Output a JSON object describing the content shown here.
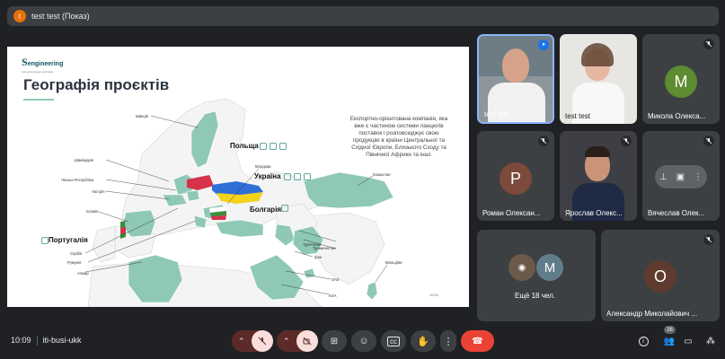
{
  "meeting": {
    "presenter_initial": "t",
    "presenting_label": "test test (Показ)",
    "time": "10:09",
    "code": "iti-busi-ukk",
    "participants_count": "26"
  },
  "slide": {
    "logo_letter": "S",
    "logo_text": "engineering",
    "logo_subtext": "інтелектуальні системи",
    "title": "Географія проєктів",
    "description": "Експортно-орієнтована компанія, яка вже є частиною системи ланцюгів поставок і розповсюджує свою продукцію в країни Центральної та Східної Європи, Близького Сходу та Північної Африки та інші.",
    "big_labels": {
      "poland": "Польща",
      "ukraine": "Україна",
      "bulgaria": "Болгарія",
      "portugal": "Португалія"
    },
    "country_labels": {
      "sweden": "Швеція",
      "switzerland": "Швейцарія",
      "czech": "Чеська Республіка",
      "austria": "Австрія",
      "spain": "Іспанія",
      "serbia": "Сербія",
      "romania": "Румунія",
      "algeria": "Алжир",
      "moldova": "Молдова",
      "kazakhstan": "Казахстан",
      "turkey": "Туреччина",
      "turkmenistan": "Туркменістан",
      "iran": "Іран",
      "uae": "ОАЕ",
      "ksa": "KSA",
      "maldives": "Мальдіви"
    },
    "page_number": "10/34"
  },
  "tiles": [
    {
      "name": "test test",
      "type": "video",
      "speaking": true
    },
    {
      "name": "test test",
      "type": "video"
    },
    {
      "name": "Микола Олекса...",
      "type": "avatar",
      "initial": "M",
      "color": "#5e8c31",
      "muted": true
    },
    {
      "name": "Роман Олексан...",
      "type": "avatar",
      "initial": "P",
      "color": "#7b4a3a",
      "muted": true
    },
    {
      "name": "Ярослав Олекс...",
      "type": "video",
      "muted": true
    },
    {
      "name": "Вячеслав Олек...",
      "type": "hover",
      "muted": true
    },
    {
      "name": "Ещё 18 чел.",
      "type": "more",
      "initial": "M"
    },
    {
      "name": "Александр Миколайович ...",
      "type": "avatar",
      "initial": "O",
      "color": "#5f3a2f",
      "muted": true
    }
  ],
  "colors": {
    "background": "#202124",
    "control": "#3c4043",
    "hangup": "#ea4335",
    "map_highlight": "#8fc9b5",
    "ukraine_blue": "#2e6fd8",
    "ukraine_yellow": "#f5d21b",
    "poland_red": "#d6324b",
    "bulgaria_green": "#3a8f3a"
  },
  "icons": [
    "chevron-up-icon",
    "mic-off-icon",
    "camera-off-icon",
    "present-icon",
    "emoji-icon",
    "captions-icon",
    "hand-icon",
    "more-vert-icon",
    "call-end-icon",
    "info-icon",
    "people-icon",
    "chat-icon",
    "activities-icon",
    "pin-icon",
    "unmute-icon"
  ]
}
